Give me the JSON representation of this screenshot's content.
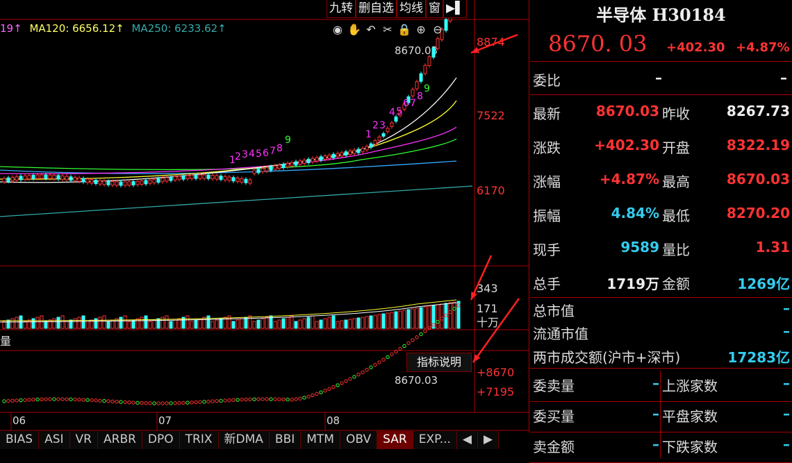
{
  "toolbar": {
    "buttons": [
      "九转",
      "删自选",
      "均线",
      "窗",
      "▶▌"
    ]
  },
  "ma_legend": [
    {
      "label": "19↑",
      "color": "#ff66ff"
    },
    {
      "label": "MA120: 6656.12↑",
      "color": "#ffff66"
    },
    {
      "label": "MA250: 6233.62↑",
      "color": "#33aaaa"
    }
  ],
  "tool_icons": [
    "eye-icon",
    "hand-icon",
    "undo-icon",
    "scissors-icon",
    "lock-icon",
    "zoom-in-icon",
    "zoom-out-icon"
  ],
  "price_axis": {
    "top": "8874",
    "mid": "7522",
    "low": "6170",
    "last_label": "8670.03"
  },
  "volume_axis": {
    "a": "343",
    "b": "171",
    "c": "十万"
  },
  "sar_axis": {
    "a": "8670",
    "b": "7195",
    "last_label": "8670.03"
  },
  "vol_label": "量",
  "indicator_button": "指标说明",
  "months": [
    "06",
    "07",
    "08"
  ],
  "nine_count": [
    "1",
    "2",
    "3",
    "4",
    "5",
    "6",
    "7",
    "8",
    "9",
    "1",
    "2",
    "3",
    "4",
    "5",
    "6",
    "7",
    "8",
    "9"
  ],
  "tabs": [
    "BIAS",
    "ASI",
    "VR",
    "ARBR",
    "DPO",
    "TRIX",
    "新DMA",
    "BBI",
    "MTM",
    "OBV",
    "SAR",
    "EXP..."
  ],
  "active_tab": "SAR",
  "chart_data": {
    "type": "candlestick",
    "last_close": 8670.03,
    "y_ticks": [
      8874,
      7522,
      6170
    ],
    "volume_ticks": [
      343,
      171
    ]
  },
  "panel": {
    "title": "半导体 H30184",
    "price": "8670. 03",
    "change": "+402.30",
    "pct": "+4.87%",
    "weibi": {
      "label": "委比",
      "v1": "–",
      "v2": "–"
    },
    "rows": [
      {
        "l1": "最新",
        "v1": "8670.03",
        "c1": "red",
        "l2": "昨收",
        "v2": "8267.73",
        "c2": "white"
      },
      {
        "l1": "涨跌",
        "v1": "+402.30",
        "c1": "red",
        "l2": "开盘",
        "v2": "8322.19",
        "c2": "red"
      },
      {
        "l1": "涨幅",
        "v1": "+4.87%",
        "c1": "red",
        "l2": "最高",
        "v2": "8670.03",
        "c2": "red"
      },
      {
        "l1": "振幅",
        "v1": "4.84%",
        "c1": "cyan",
        "l2": "最低",
        "v2": "8270.20",
        "c2": "red"
      },
      {
        "l1": "现手",
        "v1": "9589",
        "c1": "cyan",
        "l2": "量比",
        "v2": "1.31",
        "c2": "red"
      },
      {
        "l1": "总手",
        "v1": "1719万",
        "c1": "white",
        "l2": "金额",
        "v2": "1269亿",
        "c2": "cyan"
      }
    ],
    "total_cap": {
      "label": "总市值",
      "val": "–"
    },
    "float_cap": {
      "label": "流通市值",
      "val": "–"
    },
    "turnover": {
      "label": "两市成交额(沪市+深市)",
      "val": "17283亿"
    },
    "bottom": [
      {
        "l1": "委卖量",
        "v1": "–",
        "l2": "上涨家数",
        "v2": "–"
      },
      {
        "l1": "委买量",
        "v1": "–",
        "l2": "平盘家数",
        "v2": "–"
      },
      {
        "l1": "卖金额",
        "v1": "–",
        "l2": "下跌家数",
        "v2": "–"
      }
    ]
  }
}
